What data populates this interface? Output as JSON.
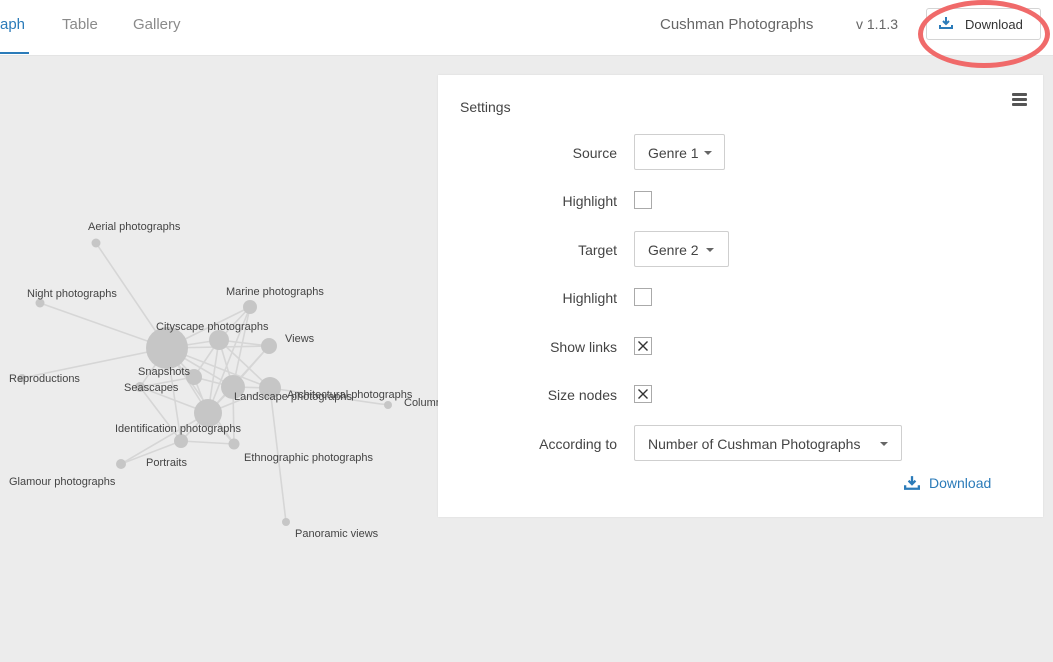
{
  "tabs": [
    {
      "label": "aph",
      "active": true
    },
    {
      "label": "Table",
      "active": false
    },
    {
      "label": "Gallery",
      "active": false
    }
  ],
  "header": {
    "app_title": "Cushman Photographs",
    "version": "v 1.1.3",
    "download_label": "Download"
  },
  "settings": {
    "title": "Settings",
    "source_label": "Source",
    "source_value": "Genre 1",
    "source_highlight_label": "Highlight",
    "source_highlight_checked": false,
    "target_label": "Target",
    "target_value": "Genre 2",
    "target_highlight_label": "Highlight",
    "target_highlight_checked": false,
    "show_links_label": "Show links",
    "show_links_checked": true,
    "size_nodes_label": "Size nodes",
    "size_nodes_checked": true,
    "according_to_label": "According to",
    "according_to_value": "Number of Cushman Photographs",
    "download_label": "Download"
  },
  "graph": {
    "node_labels": [
      "Aerial photographs",
      "Night photographs",
      "Marine photographs",
      "Cityscape photographs",
      "Views",
      "Snapshots",
      "Reproductions",
      "Seascapes",
      "Landscape photographs",
      "Architectural photographs",
      "Columns",
      "Identification photographs",
      "Portraits",
      "Ethnographic photographs",
      "Glamour photographs",
      "Panoramic views"
    ]
  },
  "colors": {
    "accent": "#2b7bb9",
    "highlight_ring": "#f06a6a",
    "node": "#c6c6c6",
    "link": "#d6d6d6"
  }
}
